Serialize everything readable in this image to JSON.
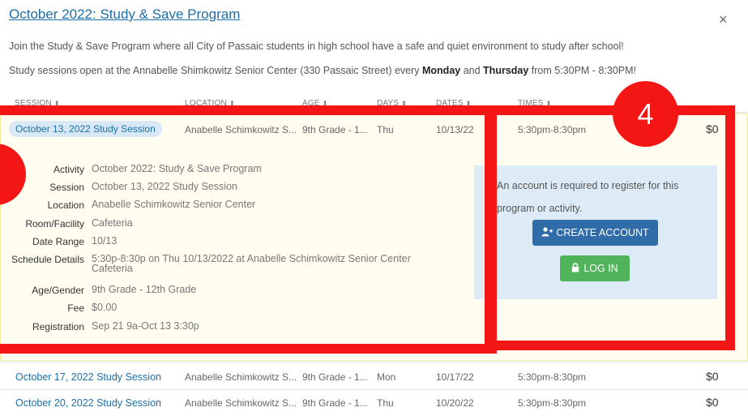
{
  "header": {
    "title": "October 2022: Study & Save Program",
    "close_label": "×",
    "desc1": "Join the Study & Save Program where all City of Passaic students in high school have a safe and quiet environment to study after school!",
    "desc2_a": "Study sessions open at the Annabelle Shimkowitz Senior Center (330 Passaic Street) every ",
    "desc2_monday": "Monday",
    "desc2_and": " and ",
    "desc2_thursday": "Thursday",
    "desc2_b": " from 5:30PM - 8:30PM!"
  },
  "table": {
    "columns": [
      "SESSION",
      "LOCATION",
      "AGE",
      "DAYS",
      "DATES",
      "TIMES"
    ],
    "sort_glyph": "⬍",
    "rows": [
      {
        "session": "October 13, 2022 Study Session",
        "location": "Anabelle Schimkowitz S...",
        "age": "9th Grade - 1...",
        "days": "Thu",
        "dates": "10/13/22",
        "times": "5:30pm-8:30pm",
        "price": "$0"
      },
      {
        "session": "October 17, 2022 Study Session",
        "location": "Anabelle Schimkowitz S...",
        "age": "9th Grade - 1...",
        "days": "Mon",
        "dates": "10/17/22",
        "times": "5:30pm-8:30pm",
        "price": "$0"
      },
      {
        "session": "October 20, 2022 Study Session",
        "location": "Anabelle Schimkowitz S...",
        "age": "9th Grade - 1...",
        "days": "Thu",
        "dates": "10/20/22",
        "times": "5:30pm-8:30pm",
        "price": "$0"
      }
    ]
  },
  "details": {
    "labels": [
      "Activity",
      "Session",
      "Location",
      "Room/Facility",
      "Date Range",
      "Schedule Details",
      "Age/Gender",
      "Fee",
      "Registration"
    ],
    "values": [
      "October 2022: Study & Save Program",
      "October 13, 2022 Study Session",
      "Anabelle Schimkowitz Senior Center",
      "Cafeteria",
      "10/13",
      "5:30p-8:30p on Thu 10/13/2022 at Anabelle Schimkowitz Senior Center Cafeteria",
      "9th Grade - 12th Grade",
      "$0.00",
      "Sep 21 9a-Oct 13 3:30p"
    ]
  },
  "register": {
    "line1": "An account is required to register for this",
    "line2": "program or activity.",
    "create_label": "CREATE ACCOUNT",
    "login_label": "LOG IN"
  },
  "annotation": {
    "number": "4",
    "color": "#f41515"
  }
}
